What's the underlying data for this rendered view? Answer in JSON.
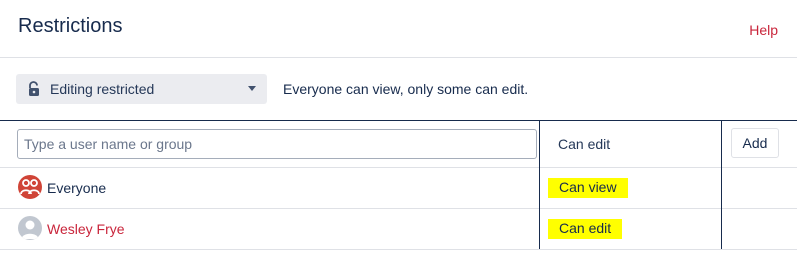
{
  "header": {
    "title": "Restrictions",
    "help_label": "Help"
  },
  "mode": {
    "selected": "Editing restricted",
    "description": "Everyone can view, only some can edit."
  },
  "table": {
    "search_placeholder": "Type a user name or group",
    "permission_header": "Can edit",
    "add_label": "Add",
    "rows": [
      {
        "name": "Everyone",
        "permission": "Can view"
      },
      {
        "name": "Wesley Frye",
        "permission": "Can edit"
      }
    ]
  },
  "colors": {
    "accent_red": "#c9253b",
    "highlight": "#ffff00",
    "group_avatar": "#d04437"
  },
  "icons": {
    "mode": "lock-open-icon",
    "dropdown": "chevron-down-icon",
    "group": "group-icon",
    "user": "user-icon"
  }
}
